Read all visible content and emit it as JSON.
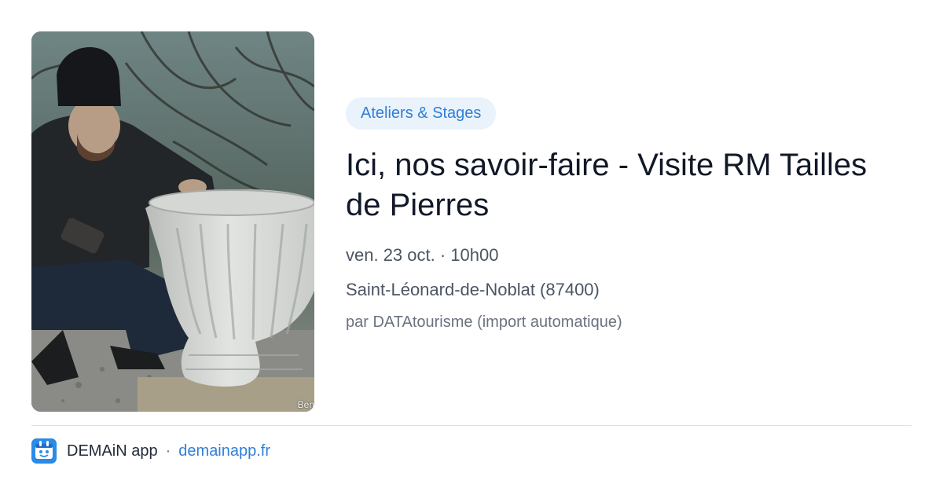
{
  "event": {
    "category": "Ateliers & Stages",
    "title": "Ici, nos savoir-faire - Visite RM Tailles de Pierres",
    "date_time": "ven. 23 oct. · 10h00",
    "location": "Saint-Léonard-de-Noblat (87400)",
    "source": "par DATAtourisme (import automatique)",
    "image": {
      "credit": "Ben"
    }
  },
  "footer": {
    "app_name": "DEMAiN app",
    "separator": "·",
    "url": "demainapp.fr",
    "logo_icon": "demain-app-logo-icon"
  },
  "colors": {
    "accent": "#2f7fd8",
    "pill_bg": "#eaf2fc",
    "logo_bg": "#2b8be6"
  }
}
